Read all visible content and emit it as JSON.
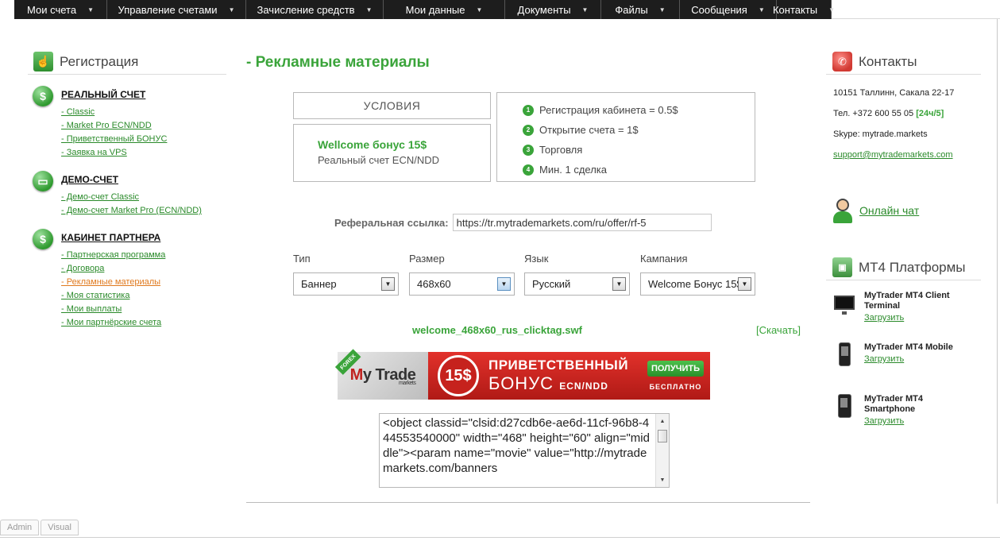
{
  "nav": [
    {
      "label": "Мои счета",
      "w": 117
    },
    {
      "label": "Управление счетами",
      "w": 175
    },
    {
      "label": "Зачисление средств",
      "w": 173
    },
    {
      "label": "Мои данные",
      "w": 153
    },
    {
      "label": "Документы",
      "w": 121
    },
    {
      "label": "Файлы",
      "w": 99
    },
    {
      "label": "Сообщения",
      "w": 122
    },
    {
      "label": "Контакты",
      "w": 121
    }
  ],
  "left": {
    "title": "Регистрация",
    "groups": [
      {
        "title": "РЕАЛЬНЫЙ СЧЕТ",
        "links": [
          "- Classic",
          "- Market Pro ECN/NDD",
          "- Приветственный БОНУС",
          "- Заявка на VPS"
        ]
      },
      {
        "title": "ДЕМО-СЧЕТ",
        "links": [
          "- Демо-счет Classic",
          "- Демо-счет Market Pro (ECN/NDD)"
        ]
      },
      {
        "title": "КАБИНЕТ ПАРТНЕРА",
        "links": [
          "- Партнерская программа",
          "- Договора",
          "- Рекламные материалы",
          "- Моя статистика",
          "- Мои выплаты",
          "- Мои партнёрские счета"
        ]
      }
    ]
  },
  "main": {
    "title": "- Рекламные материалы",
    "conditions_label": "УСЛОВИЯ",
    "bonus_title": "Wellcome бонус 15$",
    "bonus_subtitle": "Реальный счет ECN/NDD",
    "steps": [
      "Регистрация кабинета = 0.5$",
      "Открытие счета = 1$",
      "Торговля",
      "Мин. 1 сделка"
    ],
    "referral_label": "Реферальная ссылка:",
    "referral_value": "https://tr.mytrademarkets.com/ru/offer/rf-5",
    "filters": [
      {
        "label": "Тип",
        "value": "Баннер"
      },
      {
        "label": "Размер",
        "value": "468x60"
      },
      {
        "label": "Язык",
        "value": "Русский"
      },
      {
        "label": "Кампания",
        "value": "Welcome Бонус 15$"
      }
    ],
    "file_name": "welcome_468x60_rus_clicktag.swf",
    "download_label": "[Скачать]",
    "banner": {
      "forex": "FOREX",
      "brand_prefix": "M",
      "brand_rest": "y Trade",
      "brand_sub": "markets",
      "amount": "15$",
      "line1": "ПРИВЕТСТВЕННЫЙ",
      "line2": "БОНУС",
      "line2_tag": "ECN/NDD",
      "cta": "ПОЛУЧИТЬ",
      "free": "БЕСПЛАТНО"
    },
    "embed_code": "<object classid=\"clsid:d27cdb6e-ae6d-11cf-96b8-444553540000\" width=\"468\" height=\"60\" align=\"middle\"><param name=\"movie\" value=\"http://mytrademarkets.com/banners"
  },
  "right": {
    "contacts_title": "Контакты",
    "address": "10151 Таллинн, Сакала 22-17",
    "phone": "Тел. +372 600 55 05",
    "phone_hours": "[24ч/5]",
    "skype": "Skype: mytrade.markets",
    "email": "support@mytrademarkets.com",
    "chat_label": "Онлайн чат",
    "mt4_title": "MT4 Платформы",
    "platforms": [
      {
        "title": "MyTrader MT4 Client Terminal",
        "link": "Загрузить"
      },
      {
        "title": "MyTrader MT4 Mobile",
        "link": "Загрузить"
      },
      {
        "title": "MyTrader MT4 Smartphone",
        "link": "Загрузить"
      }
    ]
  },
  "admin_tabs": [
    "Admin",
    "Visual"
  ],
  "colors": {
    "accent": "#3aa43a",
    "nav": "#1d1d1d",
    "active_link": "#e07a1f"
  }
}
